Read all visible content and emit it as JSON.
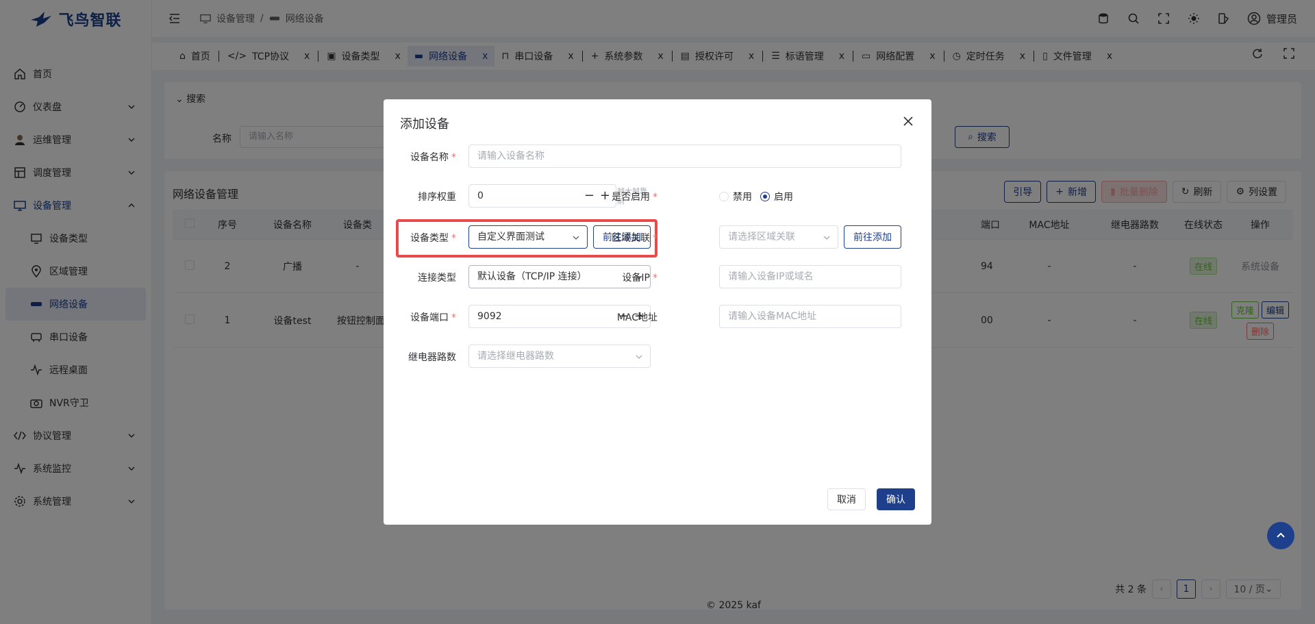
{
  "app": {
    "logo_text": "飞鸟智联",
    "footer": "© 2025 kaf",
    "user": "管理员"
  },
  "breadcrumb": [
    "设备管理",
    "/",
    "网络设备"
  ],
  "sidebar": {
    "items": [
      {
        "label": "首页",
        "icon": "home-icon"
      },
      {
        "label": "仪表盘",
        "icon": "dashboard-icon"
      },
      {
        "label": "运维管理",
        "icon": "user-avatar-icon"
      },
      {
        "label": "调度管理",
        "icon": "schedule-icon"
      },
      {
        "label": "设备管理",
        "icon": "monitor-icon"
      },
      {
        "label": "设备类型",
        "icon": "device-type-icon"
      },
      {
        "label": "区域管理",
        "icon": "location-icon"
      },
      {
        "label": "网络设备",
        "icon": "network-icon"
      },
      {
        "label": "串口设备",
        "icon": "serial-icon"
      },
      {
        "label": "远程桌面",
        "icon": "pulse-icon"
      },
      {
        "label": "NVR守卫",
        "icon": "camera-icon"
      },
      {
        "label": "协议管理",
        "icon": "code-icon"
      },
      {
        "label": "系统监控",
        "icon": "pulse-icon"
      },
      {
        "label": "系统管理",
        "icon": "gear-icon"
      }
    ]
  },
  "tabs": [
    "首页",
    "TCP协议",
    "设备类型",
    "网络设备",
    "串口设备",
    "系统参数",
    "授权许可",
    "标语管理",
    "网络配置",
    "定时任务",
    "文件管理"
  ],
  "search": {
    "title": "搜索",
    "name_label": "名称",
    "name_placeholder": "请输入名称",
    "button": "搜索"
  },
  "table": {
    "title": "网络设备管理",
    "toolbar": [
      "引导",
      "新增",
      "批量删除",
      "刷新",
      "列设置"
    ],
    "headers": [
      "序号",
      "设备名称",
      "设备类",
      "端口",
      "MAC地址",
      "继电器路数",
      "在线状态",
      "操作"
    ],
    "rows": [
      {
        "no": "2",
        "name": "广播",
        "type": "-",
        "port": "94",
        "mac": "-",
        "relay": "-",
        "status": "在线",
        "op": "系统设备"
      },
      {
        "no": "1",
        "name": "设备test",
        "type": "按钮控制面",
        "port": "00",
        "mac": "-",
        "relay": "-",
        "status": "在线",
        "ops": [
          "克隆",
          "编辑",
          "删除"
        ]
      }
    ]
  },
  "pager": {
    "total": "共 2 条",
    "page": "1",
    "size": "10 / 页"
  },
  "dialog": {
    "title": "添加设备",
    "device_name_label": "设备名称",
    "device_name_placeholder": "请输入设备名称",
    "sort_label": "排序权重",
    "sort_value": "0",
    "sort_hint": "越大越靠前",
    "enable_label": "是否启用",
    "enable_options": [
      "禁用",
      "启用"
    ],
    "device_type_label": "设备类型",
    "device_type_value": "自定义界面测试",
    "goto_add": "前往添加",
    "region_label": "区域关联",
    "region_placeholder": "请选择区域关联",
    "conn_label": "连接类型",
    "conn_value": "默认设备（TCP/IP 连接）",
    "ip_label": "设备IP",
    "ip_placeholder": "请输入设备IP或域名",
    "port_label": "设备端口",
    "port_value": "9092",
    "mac_label": "MAC地址",
    "mac_placeholder": "请输入设备MAC地址",
    "relay_label": "继电器路数",
    "relay_placeholder": "请选择继电器路数",
    "cancel": "取消",
    "confirm": "确认"
  }
}
